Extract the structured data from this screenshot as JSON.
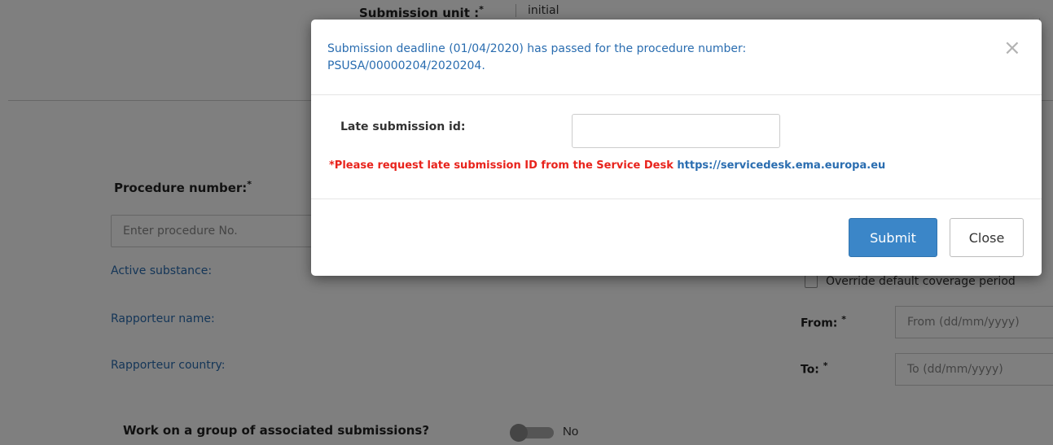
{
  "background": {
    "submission_unit_label": "Submission unit :",
    "required_mark": "*",
    "submission_unit_value": "initial",
    "procedure_label": "Procedure number:",
    "procedure_placeholder": "Enter procedure No.",
    "active_substance_label": "Active substance:",
    "rapporteur_name_label": "Rapporteur name:",
    "rapporteur_country_label": "Rapporteur country:",
    "override_label": "Override default coverage period",
    "from_label": "From:",
    "from_placeholder": "From (dd/mm/yyyy)",
    "to_label": "To:",
    "to_placeholder": "To (dd/mm/yyyy)",
    "group_question": "Work on a group of associated submissions?",
    "group_toggle_text": "No",
    "group_toggle_on": false
  },
  "modal": {
    "title_line1": "Submission deadline (01/04/2020) has passed for the procedure number:",
    "title_line2": "PSUSA/00000204/2020204.",
    "close_glyph": "×",
    "late_id_label": "Late submission id:",
    "late_id_value": "",
    "request_text": "*Please request late submission ID from the Service Desk",
    "service_desk_link": "https://servicedesk.ema.europa.eu",
    "submit_label": "Submit",
    "close_label": "Close"
  },
  "colors": {
    "accent_blue": "#2a6db0",
    "submit_bg": "#3b86c8",
    "warning_red": "#e8231c"
  }
}
